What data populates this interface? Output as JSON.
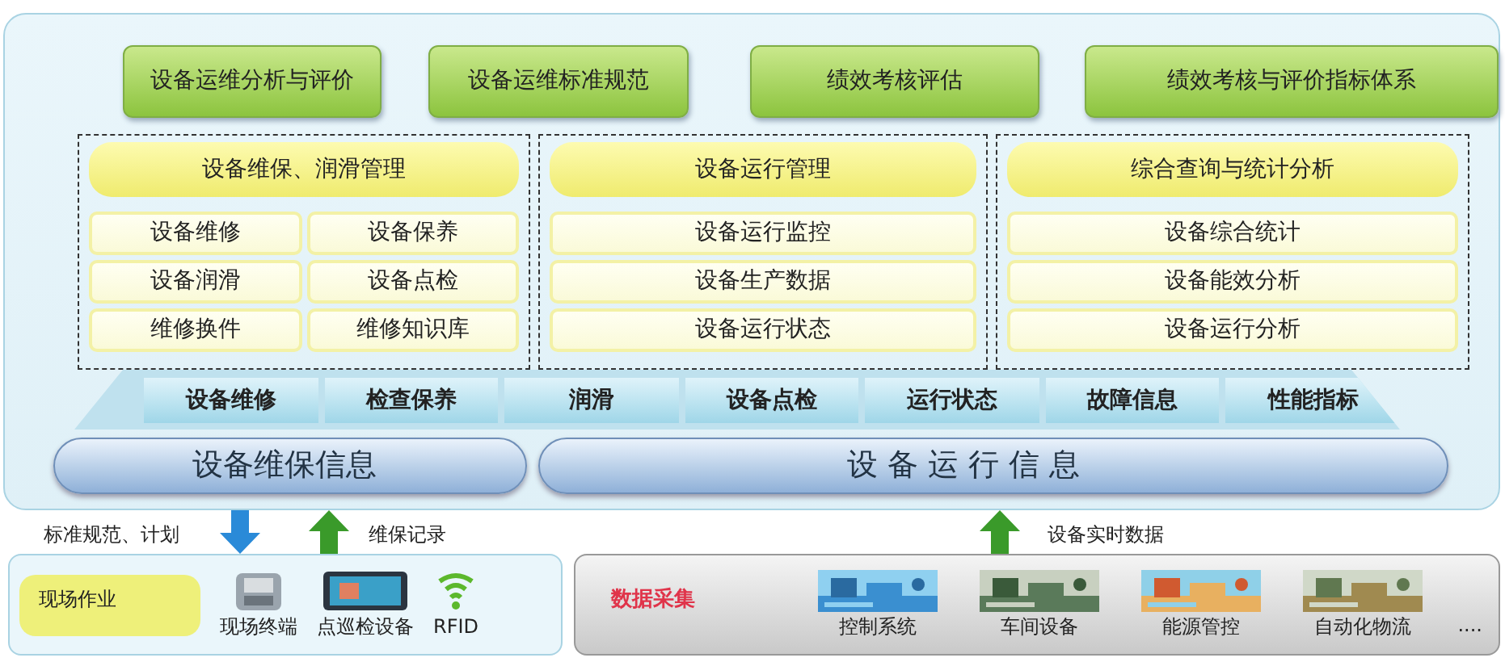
{
  "top_items": [
    "设备运维分析与评价",
    "设备运维标准规范",
    "绩效考核评估",
    "绩效考核与评价指标体系"
  ],
  "modules": [
    {
      "title": "设备维保、润滑管理",
      "kind": "two-column",
      "items": [
        "设备维修",
        "设备保养",
        "设备润滑",
        "设备点检",
        "维修换件",
        "维修知识库"
      ]
    },
    {
      "title": "设备运行管理",
      "kind": "one-column",
      "items": [
        "设备运行监控",
        "设备生产数据",
        "设备运行状态"
      ]
    },
    {
      "title": "综合查询与统计分析",
      "kind": "one-column",
      "items": [
        "设备综合统计",
        "设备能效分析",
        "设备运行分析"
      ]
    }
  ],
  "data_tabs": [
    "设备维修",
    "检查保养",
    "润滑",
    "设备点检",
    "运行状态",
    "故障信息",
    "性能指标"
  ],
  "info_bars": [
    "设备维保信息",
    "设 备 运 行 信 息"
  ],
  "flows": [
    {
      "label": "标准规范、计划",
      "kind": "down"
    },
    {
      "label": "维保记录",
      "kind": "up"
    },
    {
      "label": "设备实时数据",
      "kind": "up"
    }
  ],
  "field_panel": {
    "title": "现场作业",
    "devices": [
      {
        "label": "现场终端",
        "kind": "terminal"
      },
      {
        "label": "点巡检设备",
        "kind": "tablet"
      },
      {
        "label": "RFID",
        "kind": "rfid"
      }
    ]
  },
  "collection_panel": {
    "title": "数据采集",
    "sources": [
      "控制系统",
      "车间设备",
      "能源管控",
      "自动化物流"
    ],
    "more": "...."
  }
}
